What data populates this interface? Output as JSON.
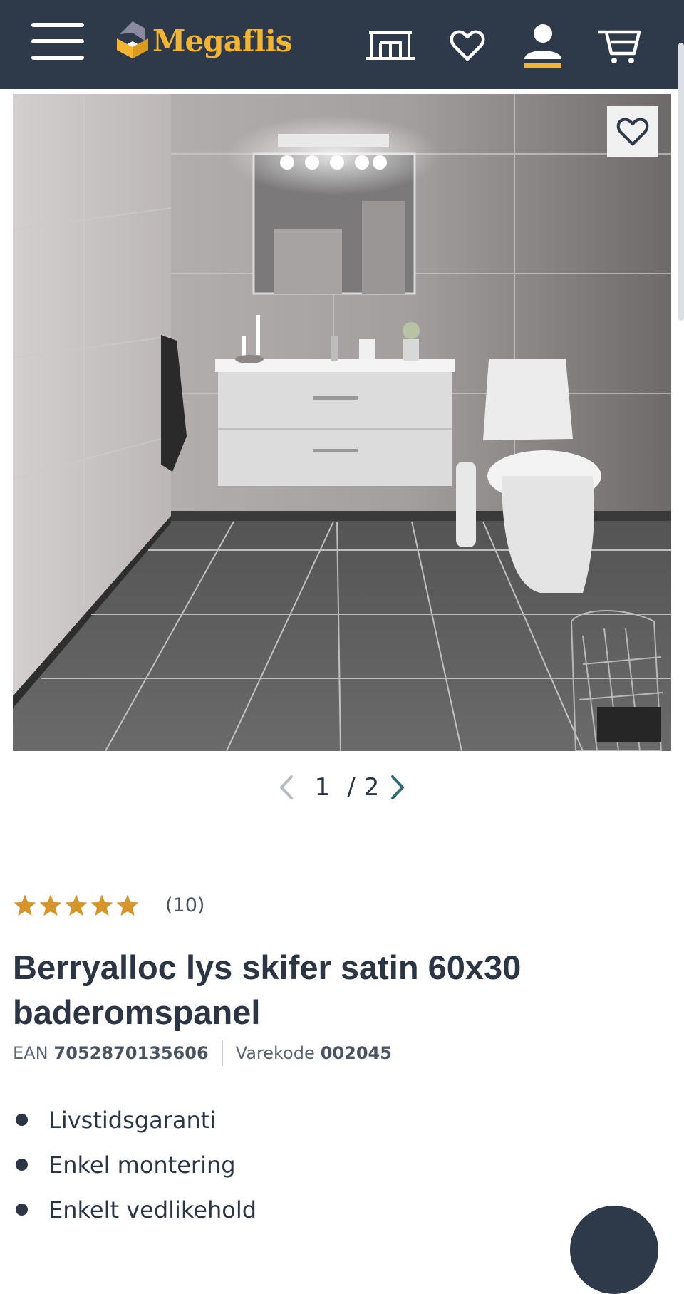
{
  "header": {
    "brand": "Megaflis",
    "menu_icon": "hamburger-menu-icon",
    "store_icon": "store-icon",
    "favorites_icon": "heart-icon",
    "account_icon": "user-icon",
    "cart_icon": "cart-icon",
    "accent_color": "#f3b432",
    "bg_color": "#2e3a4a"
  },
  "gallery": {
    "current": "1",
    "separator": "/",
    "total": "2",
    "prev_icon": "chevron-left-icon",
    "next_icon": "chevron-right-icon",
    "favorite_icon": "heart-icon"
  },
  "product": {
    "rating": 5,
    "rating_max": 5,
    "rating_count": "(10)",
    "title": "Berryalloc lys skifer satin 60x30 baderomspanel",
    "ean_label": "EAN",
    "ean": "7052870135606",
    "sku_label": "Varekode",
    "sku": "002045",
    "features": [
      "Livstidsgaranti",
      "Enkel montering",
      "Enkelt vedlikehold"
    ]
  }
}
